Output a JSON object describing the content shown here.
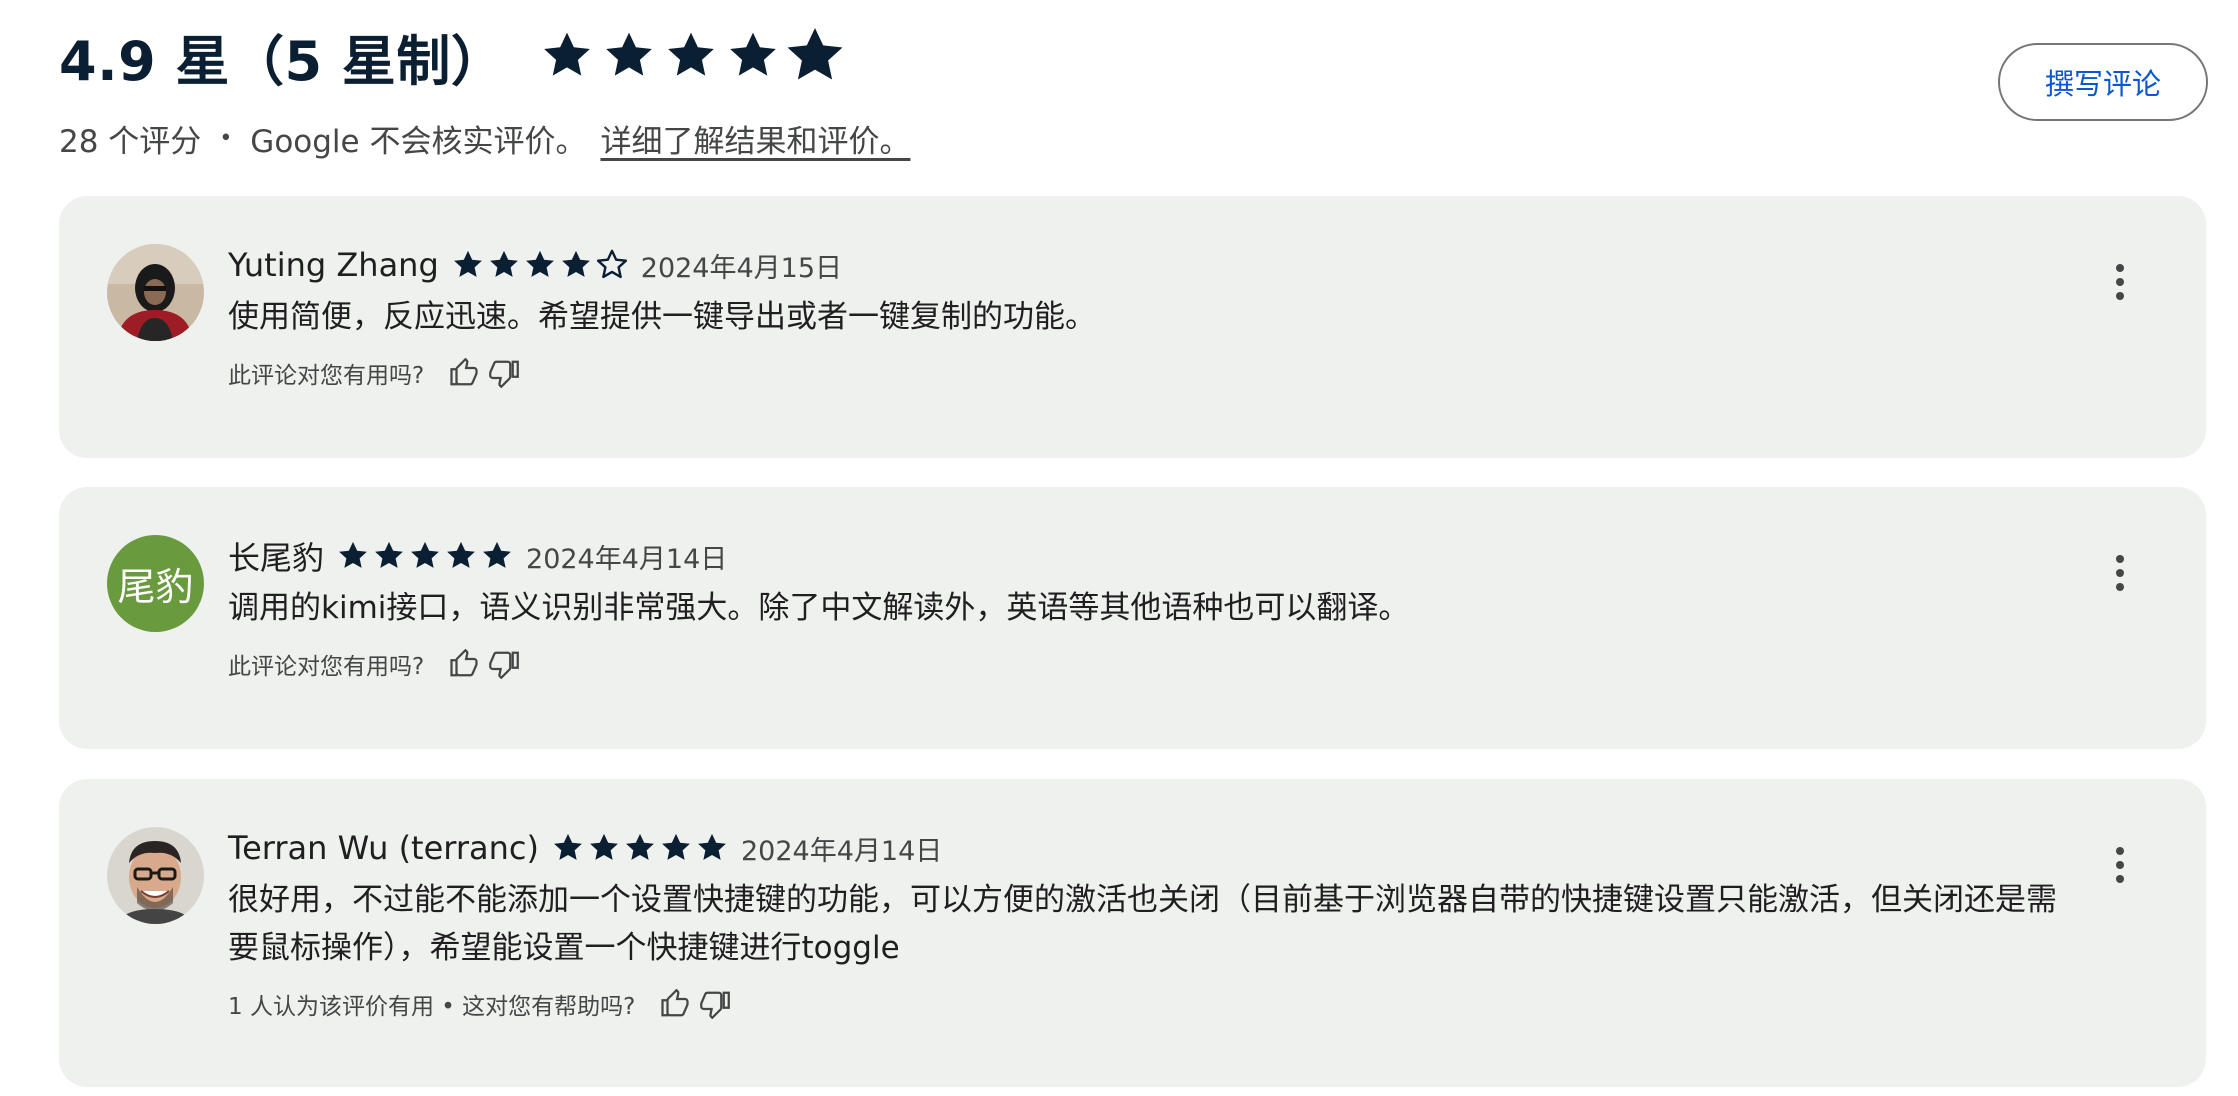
{
  "summary": {
    "title": "4.9 星（5 星制）",
    "rating_value": 4.9,
    "rating_max": 5,
    "count_text": "28 个评分",
    "separator": "•",
    "verification_text": "Google 不会核实评价。",
    "learn_more_link": "详细了解结果和评价。",
    "write_button": "撰写评论"
  },
  "reviews": [
    {
      "author": "Yuting Zhang",
      "rating": 4,
      "date": "2024年4月15日",
      "text": "使用简便，反应迅速。希望提供一键导出或者一键复制的功能。",
      "helpful_prompt": "此评论对您有用吗?",
      "avatar": "photo-person-dark-hoodie"
    },
    {
      "author": "长尾豹",
      "rating": 5,
      "date": "2024年4月14日",
      "text": "调用的kimi接口，语义识别非常强大。除了中文解读外，英语等其他语种也可以翻译。",
      "helpful_prompt": "此评论对您有用吗?",
      "avatar_text": "尾豹",
      "avatar_color": "#6a9a3e"
    },
    {
      "author": "Terran Wu (terranc)",
      "rating": 5,
      "date": "2024年4月14日",
      "text": "很好用，不过能不能添加一个设置快捷键的功能，可以方便的激活也关闭（目前基于浏览器自带的快捷键设置只能激活，但关闭还是需要鼠标操作），希望能设置一个快捷键进行toggle",
      "helpful_prompt": "1 人认为该评价有用 • 这对您有帮助吗?",
      "avatar": "photo-man-glasses-smiling"
    }
  ],
  "colors": {
    "star": "#0b1f33",
    "card_bg": "#eff1ef",
    "accent": "#0b57d0"
  },
  "icons": {
    "star": "star-icon",
    "thumb_up": "thumb-up-icon",
    "thumb_down": "thumb-down-icon",
    "more": "more-vert-icon"
  }
}
